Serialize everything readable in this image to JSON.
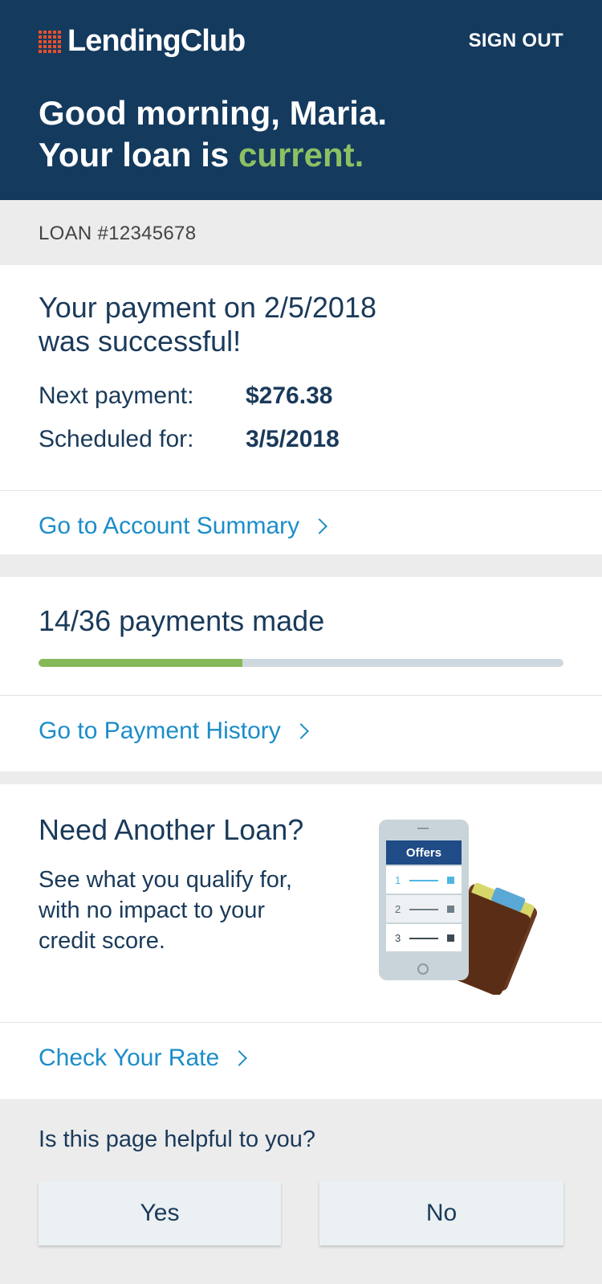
{
  "header": {
    "brand": "LendingClub",
    "sign_out": "SIGN OUT",
    "greeting_line1": "Good morning, Maria.",
    "greeting_line2_prefix": "Your loan is ",
    "greeting_status": "current.",
    "colors": {
      "background": "#143a5e",
      "status": "#8dc063",
      "logo_mark": "#e8502d"
    }
  },
  "loan": {
    "number_label": "LOAN #12345678"
  },
  "payment_card": {
    "message_line1": "Your payment on 2/5/2018",
    "message_line2": "was successful!",
    "next_payment_label": "Next payment:",
    "next_payment_value": "$276.38",
    "scheduled_label": "Scheduled for:",
    "scheduled_value": "3/5/2018",
    "link": "Go to Account Summary"
  },
  "progress_card": {
    "title": "14/36 payments made",
    "payments_made": 14,
    "payments_total": 36,
    "link": "Go to Payment History"
  },
  "promo_card": {
    "title": "Need Another Loan?",
    "body": "See what you qualify for, with no impact to your credit score.",
    "illustration_header": "Offers",
    "illustration_items": [
      "1",
      "2",
      "3"
    ],
    "link": "Check Your Rate"
  },
  "feedback": {
    "question": "Is this page helpful to you?",
    "yes": "Yes",
    "no": "No"
  }
}
